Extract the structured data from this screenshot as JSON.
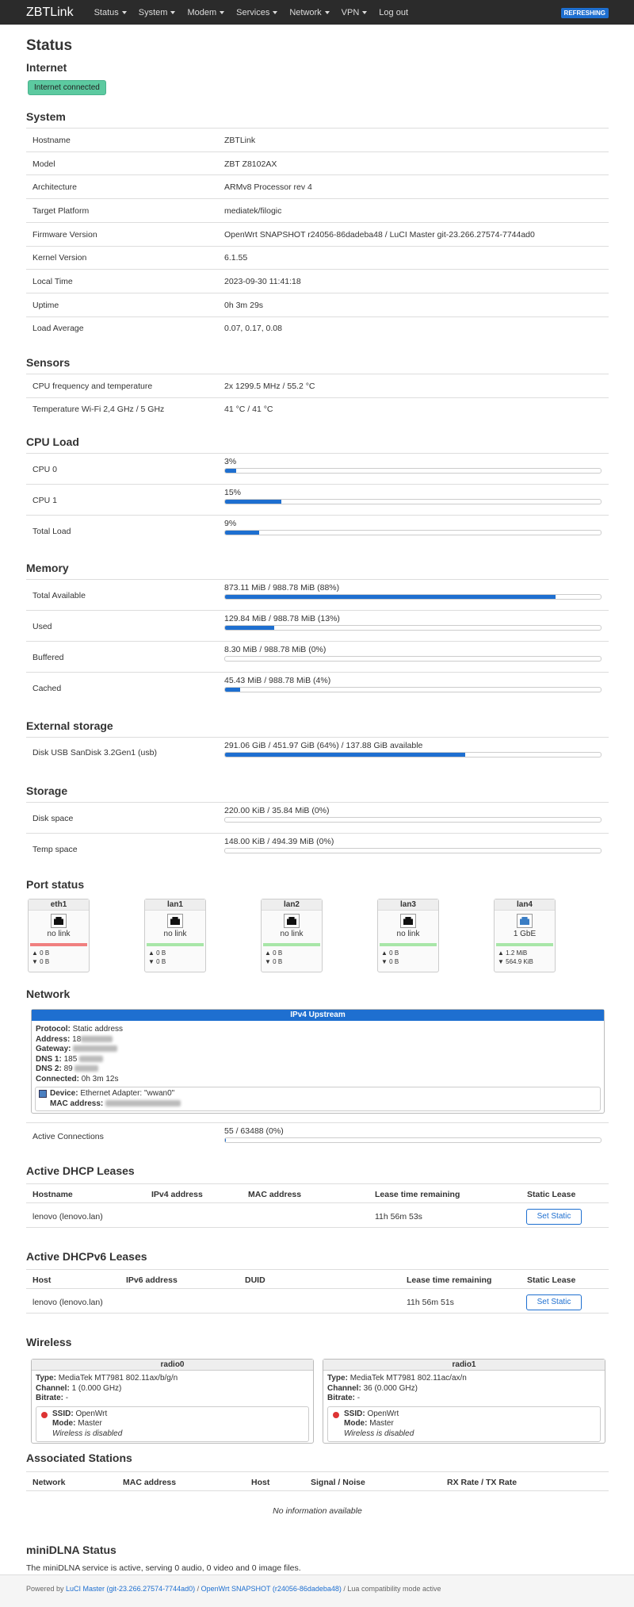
{
  "nav": {
    "brand": "ZBTLink",
    "items": [
      "Status",
      "System",
      "Modem",
      "Services",
      "Network",
      "VPN"
    ],
    "logout": "Log out",
    "refresh": "REFRESHING"
  },
  "page": {
    "title": "Status"
  },
  "internet": {
    "heading": "Internet",
    "badge": "Internet connected"
  },
  "system": {
    "heading": "System",
    "rows": [
      [
        "Hostname",
        "ZBTLink"
      ],
      [
        "Model",
        "ZBT Z8102AX"
      ],
      [
        "Architecture",
        "ARMv8 Processor rev 4"
      ],
      [
        "Target Platform",
        "mediatek/filogic"
      ],
      [
        "Firmware Version",
        "OpenWrt SNAPSHOT r24056-86dadeba48 / LuCI Master git-23.266.27574-7744ad0"
      ],
      [
        "Kernel Version",
        "6.1.55"
      ],
      [
        "Local Time",
        "2023-09-30 11:41:18"
      ],
      [
        "Uptime",
        "0h 3m 29s"
      ],
      [
        "Load Average",
        "0.07, 0.17, 0.08"
      ]
    ]
  },
  "sensors": {
    "heading": "Sensors",
    "rows": [
      [
        "CPU frequency and temperature",
        "2x 1299.5 MHz / 55.2 °C"
      ],
      [
        "Temperature Wi-Fi 2,4 GHz / 5 GHz",
        "41 °C / 41 °C"
      ]
    ]
  },
  "cpu": {
    "heading": "CPU Load",
    "rows": [
      {
        "k": "CPU 0",
        "t": "3%",
        "p": 0.03
      },
      {
        "k": "CPU 1",
        "t": "15%",
        "p": 0.15
      },
      {
        "k": "Total Load",
        "t": "9%",
        "p": 0.09
      }
    ]
  },
  "memory": {
    "heading": "Memory",
    "rows": [
      {
        "k": "Total Available",
        "t": "873.11 MiB / 988.78 MiB (88%)",
        "p": 0.88
      },
      {
        "k": "Used",
        "t": "129.84 MiB / 988.78 MiB (13%)",
        "p": 0.13
      },
      {
        "k": "Buffered",
        "t": "8.30 MiB / 988.78 MiB (0%)",
        "p": 0.0
      },
      {
        "k": "Cached",
        "t": "45.43 MiB / 988.78 MiB (4%)",
        "p": 0.04
      }
    ]
  },
  "external": {
    "heading": "External storage",
    "rows": [
      {
        "k": "Disk USB SanDisk 3.2Gen1 (usb)",
        "t": "291.06 GiB / 451.97 GiB (64%) / 137.88 GiB available",
        "p": 0.64
      }
    ]
  },
  "storage": {
    "heading": "Storage",
    "rows": [
      {
        "k": "Disk space",
        "t": "220.00 KiB / 35.84 MiB (0%)",
        "p": 0.0
      },
      {
        "k": "Temp space",
        "t": "148.00 KiB / 494.39 MiB (0%)",
        "p": 0.0
      }
    ]
  },
  "ports": {
    "heading": "Port status",
    "items": [
      {
        "name": "eth1",
        "status": "no link",
        "tx": "▲ 0 B",
        "rx": "▼ 0 B",
        "color": "#f08080"
      },
      {
        "name": "lan1",
        "status": "no link",
        "tx": "▲ 0 B",
        "rx": "▼ 0 B",
        "color": "#a8e6a8"
      },
      {
        "name": "lan2",
        "status": "no link",
        "tx": "▲ 0 B",
        "rx": "▼ 0 B",
        "color": "#a8e6a8"
      },
      {
        "name": "lan3",
        "status": "no link",
        "tx": "▲ 0 B",
        "rx": "▼ 0 B",
        "color": "#a8e6a8"
      },
      {
        "name": "lan4",
        "status": "1 GbE",
        "tx": "▲ 1.2 MiB",
        "rx": "▼ 564.9 KiB",
        "color": "#a8e6a8"
      }
    ]
  },
  "network": {
    "heading": "Network",
    "box_title": "IPv4 Upstream",
    "protocol_k": "Protocol:",
    "protocol_v": "Static address",
    "address_k": "Address:",
    "address_v": "18",
    "gateway_k": "Gateway:",
    "dns1_k": "DNS 1:",
    "dns1_v": "185",
    "dns2_k": "DNS 2:",
    "dns2_v": "89",
    "connected_k": "Connected:",
    "connected_v": "0h 3m 12s",
    "device_k": "Device:",
    "device_v": "Ethernet Adapter: \"wwan0\"",
    "mac_k": "MAC address:",
    "active_k": "Active Connections",
    "active_t": "55 / 63488 (0%)",
    "active_p": 0.0009
  },
  "dhcp": {
    "heading": "Active DHCP Leases",
    "cols": [
      "Hostname",
      "IPv4 address",
      "MAC address",
      "Lease time remaining",
      "Static Lease"
    ],
    "row": {
      "host": "lenovo (lenovo.lan)",
      "lease": "11h 56m 53s",
      "btn": "Set Static"
    }
  },
  "dhcp6": {
    "heading": "Active DHCPv6 Leases",
    "cols": [
      "Host",
      "IPv6 address",
      "DUID",
      "Lease time remaining",
      "Static Lease"
    ],
    "row": {
      "host": "lenovo (lenovo.lan)",
      "lease": "11h 56m 51s",
      "btn": "Set Static"
    }
  },
  "wireless": {
    "heading": "Wireless",
    "radios": [
      {
        "name": "radio0",
        "type_k": "Type:",
        "type_v": "MediaTek MT7981 802.11ax/b/g/n",
        "chan_k": "Channel:",
        "chan_v": "1 (0.000 GHz)",
        "bit_k": "Bitrate:",
        "bit_v": "-",
        "ssid_k": "SSID:",
        "ssid_v": "OpenWrt",
        "mode_k": "Mode:",
        "mode_v": "Master",
        "disabled": "Wireless is disabled"
      },
      {
        "name": "radio1",
        "type_k": "Type:",
        "type_v": "MediaTek MT7981 802.11ac/ax/n",
        "chan_k": "Channel:",
        "chan_v": "36 (0.000 GHz)",
        "bit_k": "Bitrate:",
        "bit_v": "-",
        "ssid_k": "SSID:",
        "ssid_v": "OpenWrt",
        "mode_k": "Mode:",
        "mode_v": "Master",
        "disabled": "Wireless is disabled"
      }
    ]
  },
  "stations": {
    "heading": "Associated Stations",
    "cols": [
      "Network",
      "MAC address",
      "Host",
      "Signal / Noise",
      "RX Rate / TX Rate"
    ],
    "empty": "No information available"
  },
  "dlna": {
    "heading": "miniDLNA Status",
    "text": "The miniDLNA service is active, serving 0 audio, 0 video and 0 image files."
  },
  "footer": {
    "pre": "Powered by ",
    "luci": "LuCI Master (git-23.266.27574-7744ad0)",
    "sep": " / ",
    "owrt": "OpenWrt SNAPSHOT (r24056-86dadeba48)",
    "post": " / Lua compatibility mode active"
  }
}
